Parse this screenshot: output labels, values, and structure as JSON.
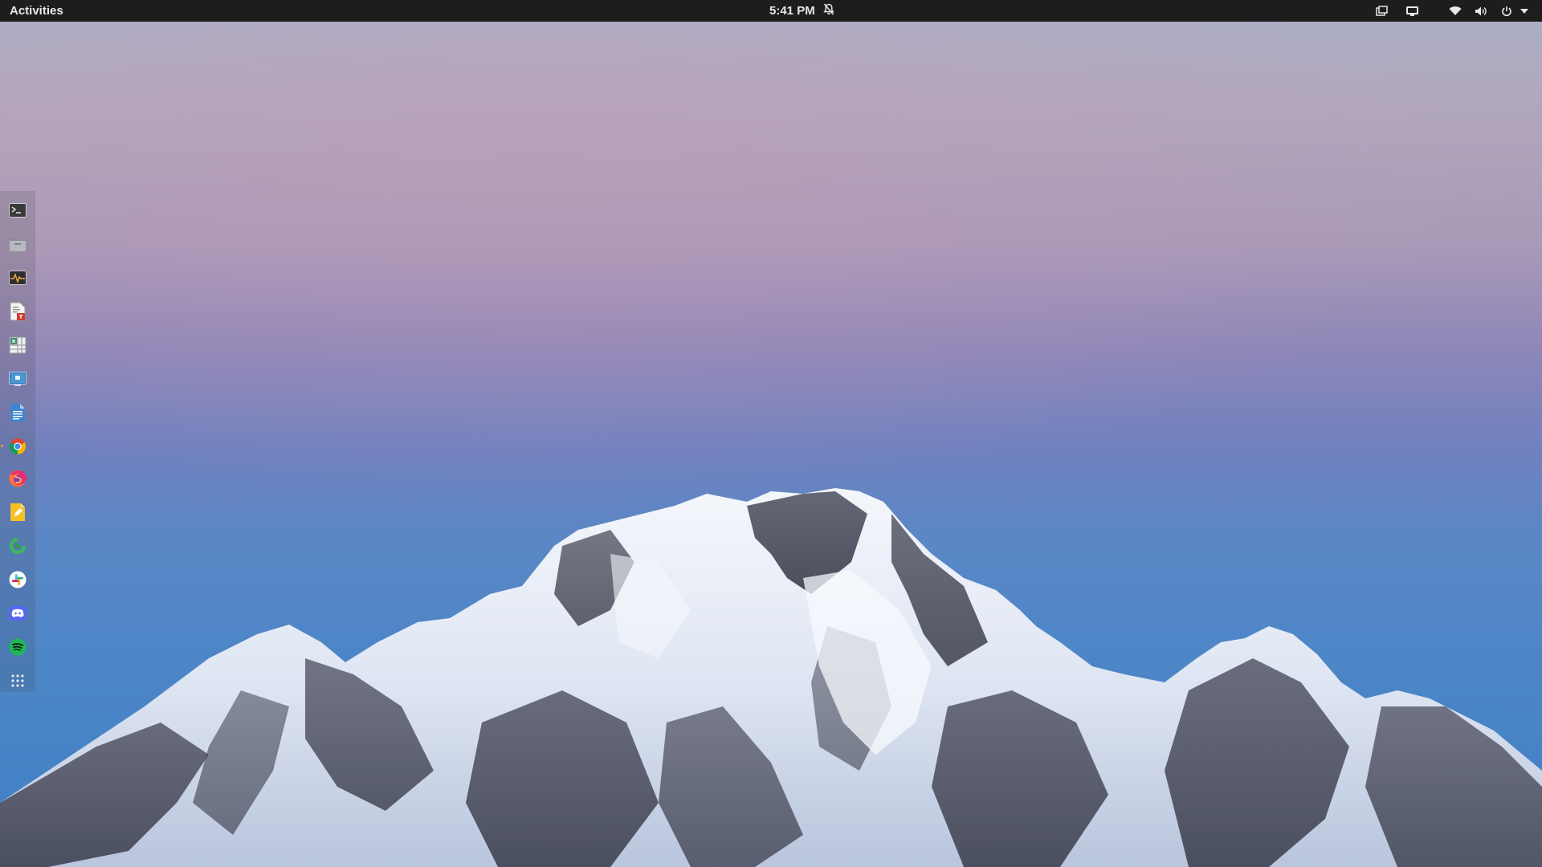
{
  "topbar": {
    "activities_label": "Activities",
    "clock": "5:41 PM"
  },
  "icons": {
    "notifications": "bell-muted-icon",
    "tray": [
      "screenshot-icon",
      "display-icon",
      "wifi-icon",
      "volume-icon",
      "power-icon",
      "chevron-down-icon"
    ]
  },
  "dock": {
    "items": [
      {
        "name": "terminal",
        "icon": "terminal-icon"
      },
      {
        "name": "files",
        "icon": "folder-icon"
      },
      {
        "name": "system-monitor",
        "icon": "system-monitor-icon"
      },
      {
        "name": "document-viewer",
        "icon": "pdf-document-icon"
      },
      {
        "name": "spreadsheet",
        "icon": "spreadsheet-icon"
      },
      {
        "name": "remote-desktop",
        "icon": "remote-desktop-icon"
      },
      {
        "name": "text-editor",
        "icon": "text-document-icon"
      },
      {
        "name": "chrome",
        "icon": "chrome-icon"
      },
      {
        "name": "firefox",
        "icon": "firefox-icon",
        "running": true
      },
      {
        "name": "notes",
        "icon": "notes-icon"
      },
      {
        "name": "green-app",
        "icon": "green-circle-icon"
      },
      {
        "name": "slack",
        "icon": "slack-icon"
      },
      {
        "name": "discord",
        "icon": "discord-icon"
      },
      {
        "name": "spotify",
        "icon": "spotify-icon"
      },
      {
        "name": "show-applications",
        "icon": "app-grid-icon"
      }
    ]
  },
  "colors": {
    "topbar_bg": "#1d1d1d",
    "running_indicator": "#f0a030"
  }
}
